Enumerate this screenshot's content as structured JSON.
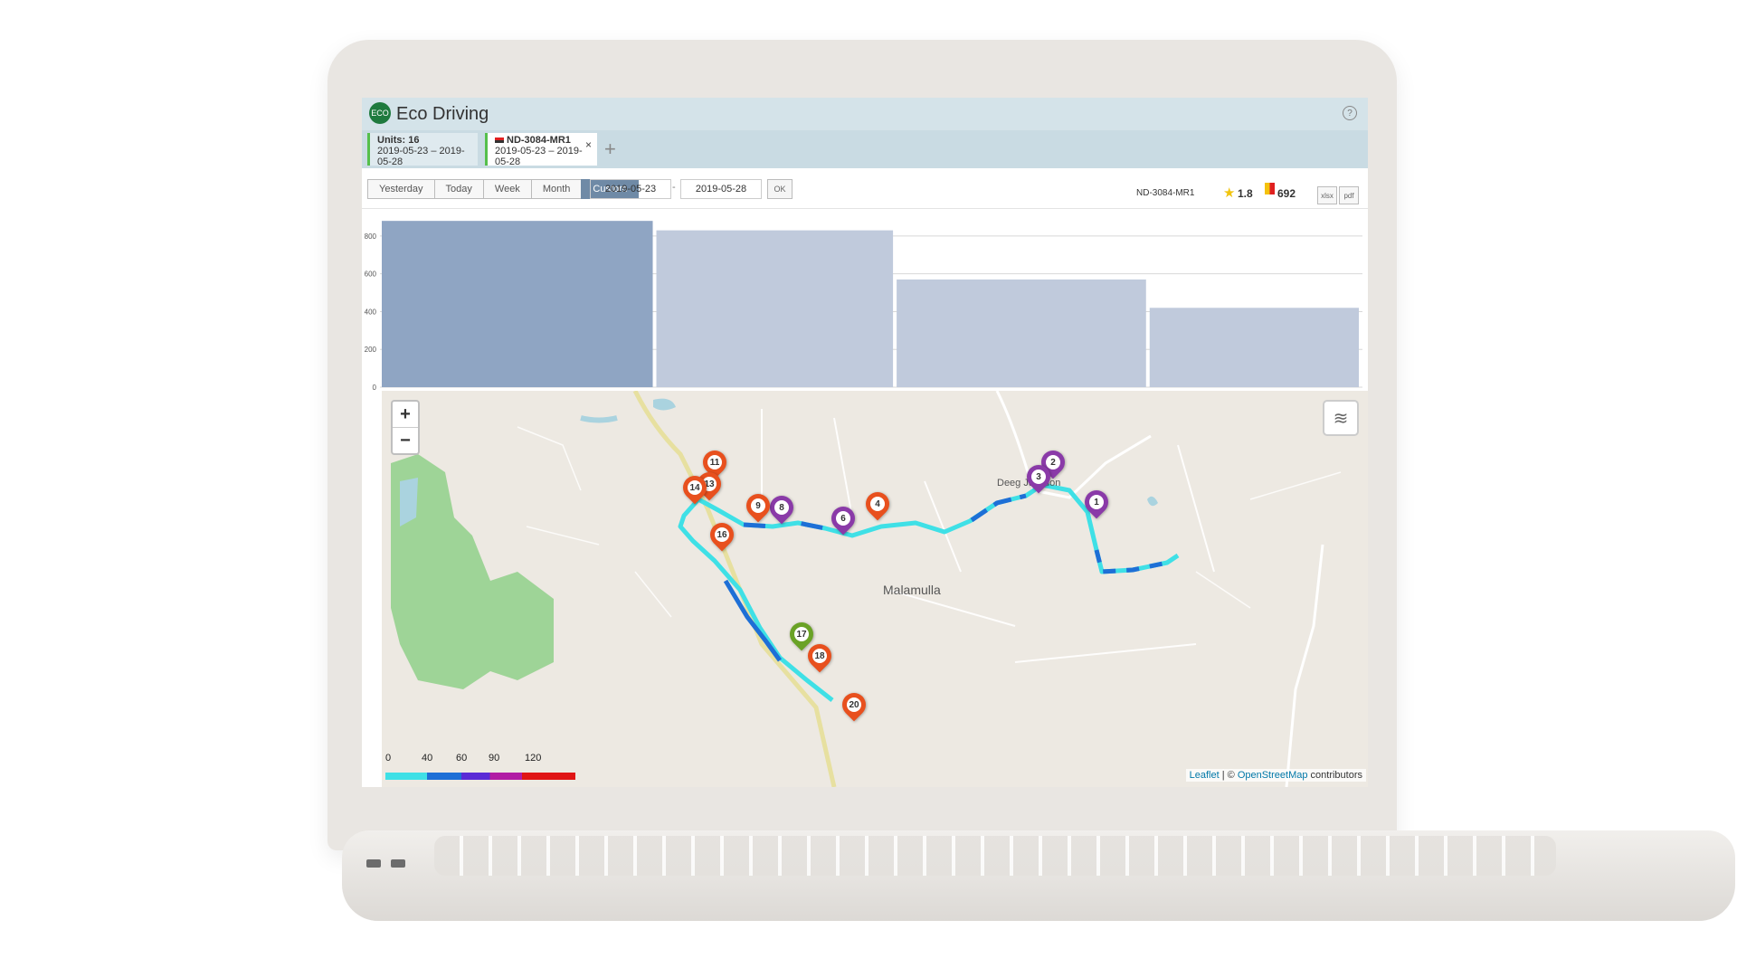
{
  "app": {
    "title": "Eco Driving",
    "logo_text": "ECO",
    "help_symbol": "?"
  },
  "tabs": [
    {
      "title": "Units: 16",
      "period": "2019-05-23 – 2019-05-28"
    },
    {
      "title": "ND-3084-MR1",
      "period": "2019-05-23 – 2019-05-28",
      "close": "×"
    }
  ],
  "tab_add": "+",
  "toolbar": {
    "ranges": [
      "Yesterday",
      "Today",
      "Week",
      "Month",
      "Custom"
    ],
    "active_range": "Custom",
    "date_from": "2019-05-23",
    "date_separator": "-",
    "date_to": "2019-05-28",
    "ok_label": "OK",
    "unit_name": "ND-3084-MR1",
    "rating": "1.8",
    "penalty": "692",
    "export_xlsx": "xlsx",
    "export_pdf": "pdf"
  },
  "chart_data": {
    "type": "bar",
    "categories": [
      "",
      "",
      "",
      ""
    ],
    "values": [
      880,
      830,
      570,
      420
    ],
    "yticks": [
      0,
      200,
      400,
      600,
      800
    ],
    "ylim": [
      0,
      900
    ],
    "bar_colors": [
      "#8fa5c3",
      "#c0cadc",
      "#c0cadc",
      "#c0cadc"
    ],
    "grid": true
  },
  "map": {
    "zoom_in": "+",
    "zoom_out": "−",
    "place_label": "Malamulla",
    "place_label_2": "Deeg Junction",
    "attribution_leaflet": "Leaflet",
    "attribution_sep": " | © ",
    "attribution_osm": "OpenStreetMap",
    "attribution_tail": " contributors",
    "speed_legend": [
      "0",
      "40",
      "60",
      "90",
      "120"
    ],
    "markers": [
      {
        "label": "1",
        "color": "#8a3aa8"
      },
      {
        "label": "2",
        "color": "#8a3aa8"
      },
      {
        "label": "3",
        "color": "#8a3aa8"
      },
      {
        "label": "4",
        "color": "#e8501e"
      },
      {
        "label": "6",
        "color": "#8a3aa8"
      },
      {
        "label": "8",
        "color": "#8a3aa8"
      },
      {
        "label": "9",
        "color": "#e8501e"
      },
      {
        "label": "11",
        "color": "#e8501e"
      },
      {
        "label": "13",
        "color": "#e8501e"
      },
      {
        "label": "14",
        "color": "#e8501e"
      },
      {
        "label": "16",
        "color": "#e8501e"
      },
      {
        "label": "17",
        "color": "#6aa226"
      },
      {
        "label": "18",
        "color": "#e8501e"
      },
      {
        "label": "20",
        "color": "#e8501e"
      }
    ]
  }
}
